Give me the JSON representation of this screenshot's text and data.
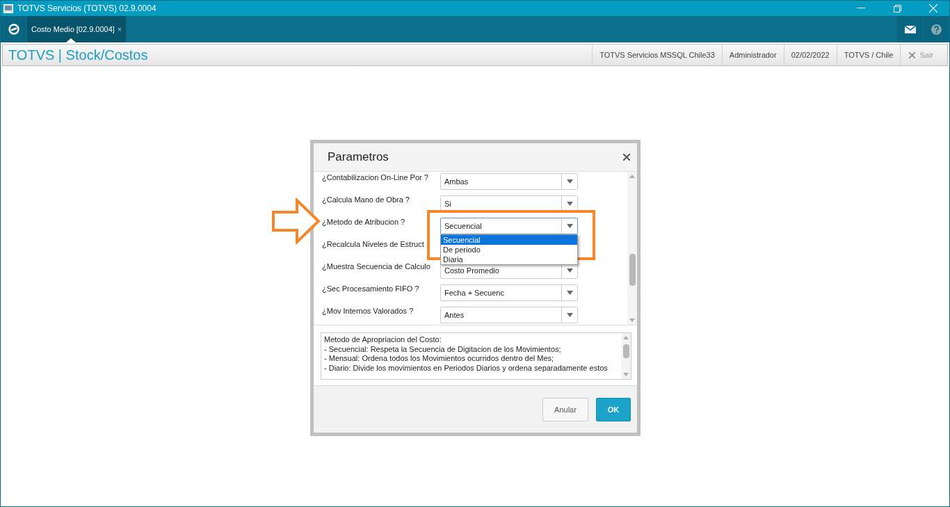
{
  "window": {
    "title": "TOTVS Servicios (TOTVS) 02.9.0004"
  },
  "tabs": [
    {
      "label": "Costo Medio [02.9.0004]",
      "selected": true,
      "close": "×"
    }
  ],
  "header": {
    "brand": "TOTVS | Stock/Costos",
    "info": [
      "TOTVS Servicios MSSQL Chile33",
      "Administrador",
      "02/02/2022",
      "TOTVS / Chile"
    ],
    "exit": "Sair"
  },
  "dialog": {
    "title": "Parametros",
    "parameters": [
      {
        "label": "¿Contabilizacion On-Line Por ?",
        "value": "Ambas",
        "expanded": false
      },
      {
        "label": "¿Calcula Mano de Obra ?",
        "value": "Si",
        "expanded": false
      },
      {
        "label": "¿Metodo de  Atribucion ?",
        "value": "Secuencial",
        "expanded": true,
        "options": [
          {
            "label": "Secuencial",
            "selected": true
          },
          {
            "label": "De periodo",
            "selected": false
          },
          {
            "label": "Diaria",
            "selected": false
          }
        ]
      },
      {
        "label": "¿Recalcula Niveles de Estruct"
      },
      {
        "label": "¿Muestra Secuencia de Calculo",
        "value": "Costo Promedio",
        "expanded": false
      },
      {
        "label": "¿Sec Procesamiento FIFO ?",
        "value": "Fecha + Secuenc",
        "expanded": false
      },
      {
        "label": "¿Mov Internos Valorados ?",
        "value": "Antes",
        "expanded": false
      }
    ],
    "description": [
      "Metodo de Apropriacion del Costo:",
      "- Secuencial: Respeta la Secuencia de Digitacion de los Movimientos;",
      "- Mensual: Ordena todos los Movimientos ocurridos dentro del Mes;",
      "- Diario: Divide los movimientos en Periodos Diarios y ordena separadamente estos"
    ],
    "buttons": [
      {
        "label": "Anular",
        "kind": "secondary"
      },
      {
        "label": "OK",
        "kind": "primary"
      }
    ]
  }
}
